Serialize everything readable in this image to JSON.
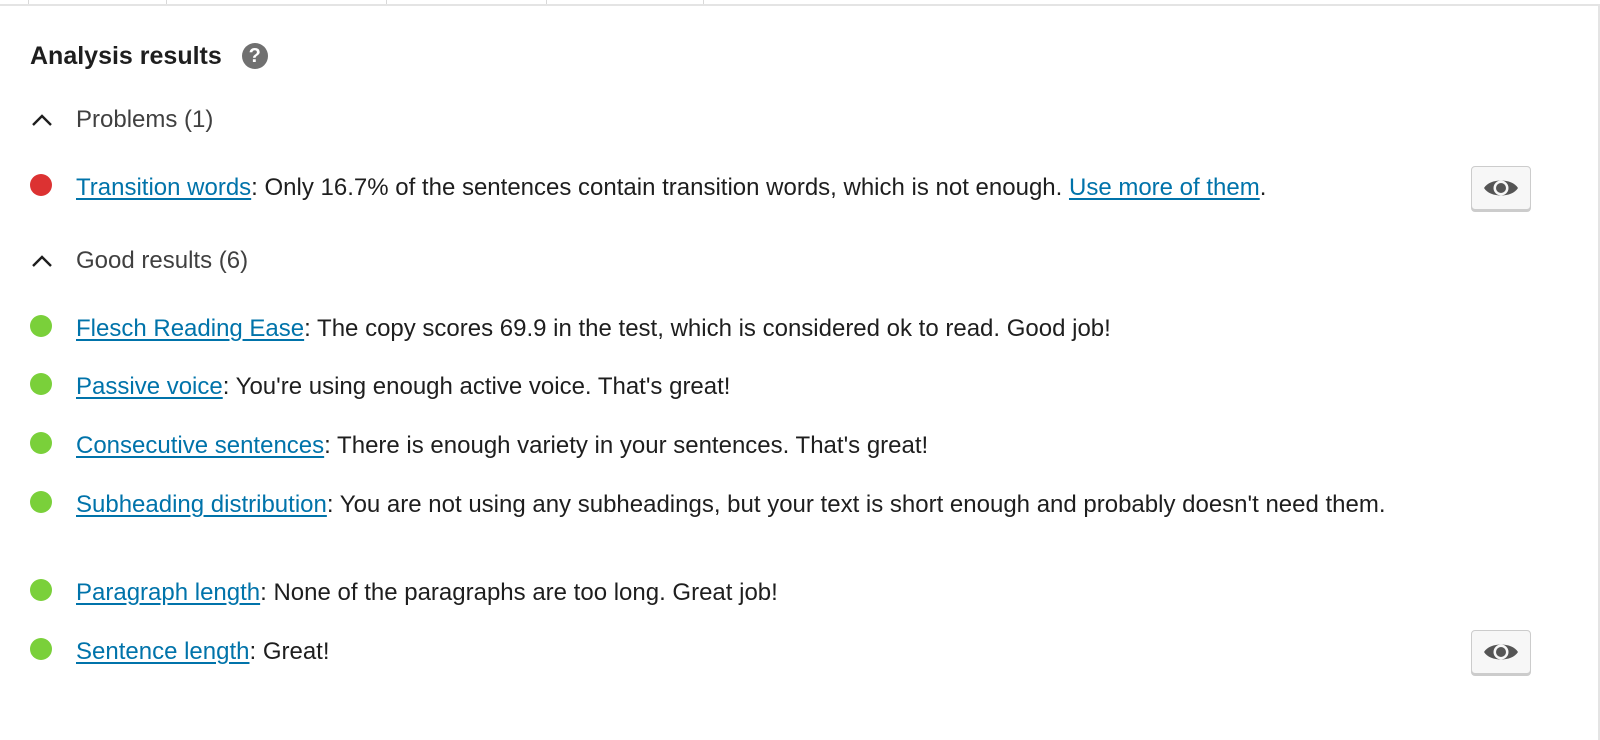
{
  "panel": {
    "title": "Analysis results",
    "help_icon": "question-circle-icon",
    "help_glyph": "?"
  },
  "problems": {
    "label": "Problems (1)",
    "chevron_icon": "chevron-up-icon",
    "items": [
      {
        "status": "bad",
        "link": "Transition words",
        "text": ": Only 16.7% of the sentences contain transition words, which is not enough. ",
        "link2": "Use more of them",
        "text_end": ".",
        "has_eye_button": true
      }
    ]
  },
  "good": {
    "label": "Good results (6)",
    "chevron_icon": "chevron-up-icon",
    "items": [
      {
        "status": "good",
        "link": "Flesch Reading Ease",
        "text": ": The copy scores 69.9 in the test, which is considered ok to read. Good job!"
      },
      {
        "status": "good",
        "link": "Passive voice",
        "text": ": You're using enough active voice. That's great!"
      },
      {
        "status": "good",
        "link": "Consecutive sentences",
        "text": ": There is enough variety in your sentences. That's great!"
      },
      {
        "status": "good",
        "link": "Subheading distribution",
        "text": ": You are not using any subheadings, but your text is short enough and probably doesn't need them."
      },
      {
        "status": "good",
        "link": "Paragraph length",
        "text": ": None of the paragraphs are too long. Great job!"
      },
      {
        "status": "good",
        "link": "Sentence length",
        "text": ": Great!",
        "has_eye_button": true
      }
    ]
  },
  "colors": {
    "bad": "#dc3232",
    "good": "#7ad03a",
    "link": "#0073aa"
  },
  "eye_icon": "eye-icon"
}
